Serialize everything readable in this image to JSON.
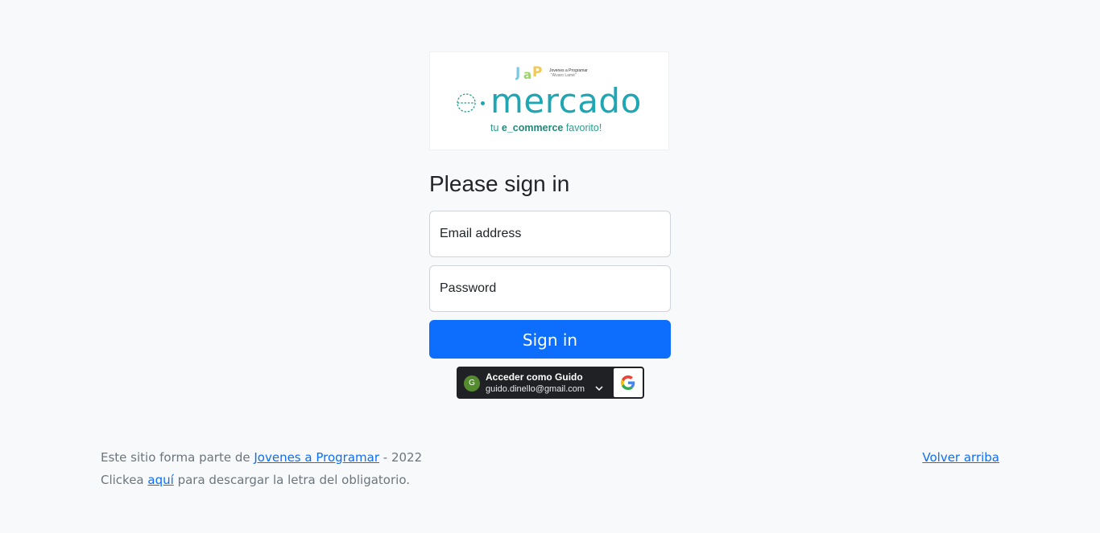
{
  "logo": {
    "badge_text": "Jovenes a Programar",
    "badge_subtext": "\"Alvaro Lamé\"",
    "brand": "mercado",
    "tagline_prefix": "tu ",
    "tagline_bold": "e_commerce",
    "tagline_suffix": " favorito!",
    "colors": {
      "primary": "#1fa6b3",
      "secondary": "#2a9d8f"
    }
  },
  "form": {
    "title": "Please sign in",
    "email_placeholder": "Email address",
    "password_placeholder": "Password",
    "submit_label": "Sign in",
    "accent": "#0d6efd"
  },
  "google": {
    "avatar_letter": "G",
    "account_label": "Acceder como Guido",
    "account_email": "guido.dinello@gmail.com",
    "icons": [
      "chevron-down-icon",
      "google-logo-icon"
    ]
  },
  "footer": {
    "line1_prefix": "Este sitio forma parte de ",
    "line1_link": "Jovenes a Programar",
    "line1_suffix": " - 2022",
    "line2_prefix": "Clickea ",
    "line2_link": "aquí",
    "line2_suffix": " para descargar la letra del obligatorio.",
    "back_to_top": "Volver arriba"
  }
}
